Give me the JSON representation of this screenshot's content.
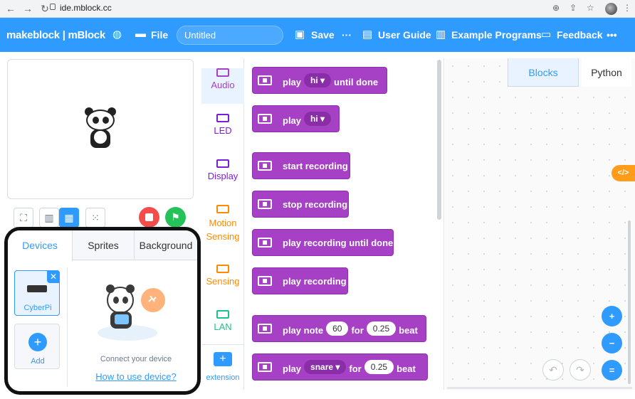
{
  "browser": {
    "url": "ide.mblock.cc"
  },
  "topbar": {
    "logo": "makeblock | mBlock",
    "file_label": "File",
    "title_value": "Untitled",
    "save_label": "Save",
    "more_label": "···",
    "user_guide_label": "User Guide",
    "examples_label": "Example Programs",
    "feedback_label": "Feedback",
    "overflow_label": "•••"
  },
  "device_panel": {
    "tabs": [
      "Devices",
      "Sprites",
      "Background"
    ],
    "device_name": "CyberPi",
    "add_label": "Add",
    "connect_text": "Connect your device",
    "howto_link": "How to use device?"
  },
  "categories": [
    {
      "label": "Audio",
      "color": "#a640c4"
    },
    {
      "label": "LED",
      "color": "#7b1fd6"
    },
    {
      "label": "Display",
      "color": "#7b1fd6"
    },
    {
      "label": "Motion Sensing",
      "color": "#ff8a00"
    },
    {
      "label": "Sensing",
      "color": "#ff8a00"
    },
    {
      "label": "LAN",
      "color": "#1ec28b"
    }
  ],
  "extension_label": "extension",
  "blocks": {
    "b1": {
      "pre": "play",
      "pill": "hi ▾",
      "post": "until done"
    },
    "b2": {
      "pre": "play",
      "pill": "hi ▾"
    },
    "b3": {
      "pre": "start recording"
    },
    "b4": {
      "pre": "stop recording"
    },
    "b5": {
      "pre": "play recording until done"
    },
    "b6": {
      "pre": "play recording"
    },
    "b7": {
      "pre": "play note",
      "val1": "60",
      "mid": "for",
      "val2": "0.25",
      "post": "beat"
    },
    "b8": {
      "pre": "play",
      "pill": "snare ▾",
      "mid": "for",
      "val2": "0.25",
      "post": "beat"
    }
  },
  "workspace": {
    "tab_blocks": "Blocks",
    "tab_python": "Python",
    "code_toggle": "</>"
  },
  "colors": {
    "accent": "#2f9bff",
    "block": "#a640c4"
  }
}
